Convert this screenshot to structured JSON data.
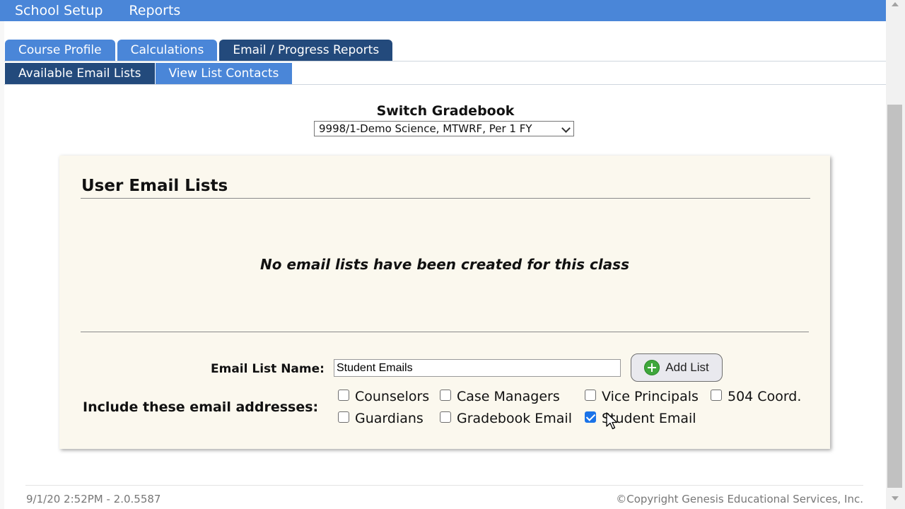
{
  "topnav": {
    "items": [
      "School Setup",
      "Reports"
    ]
  },
  "tabs": [
    "Course Profile",
    "Calculations",
    "Email / Progress Reports"
  ],
  "subtabs": [
    "Available Email Lists",
    "View List Contacts"
  ],
  "switch": {
    "title": "Switch Gradebook",
    "selected": "9998/1-Demo Science, MTWRF, Per 1 FY"
  },
  "panel": {
    "title": "User Email Lists",
    "empty_message": "No email lists have been created for this class",
    "name_label": "Email List Name:",
    "name_value": "Student Emails",
    "add_button": "Add List",
    "include_label": "Include these email addresses:",
    "options": [
      {
        "label": "Counselors",
        "checked": false
      },
      {
        "label": "Case Managers",
        "checked": false
      },
      {
        "label": "Vice Principals",
        "checked": false
      },
      {
        "label": "504 Coord.",
        "checked": false
      },
      {
        "label": "Guardians",
        "checked": false
      },
      {
        "label": "Gradebook Email",
        "checked": false
      },
      {
        "label": "Student Email",
        "checked": true
      }
    ]
  },
  "footer": {
    "left": "9/1/20 2:52PM - 2.0.5587",
    "right": "©Copyright Genesis Educational Services, Inc."
  },
  "colors": {
    "nav_blue": "#4a86d8",
    "tab_navy": "#234a7c",
    "panel_bg": "#fbf8ee",
    "add_icon": "#3fa73c"
  }
}
